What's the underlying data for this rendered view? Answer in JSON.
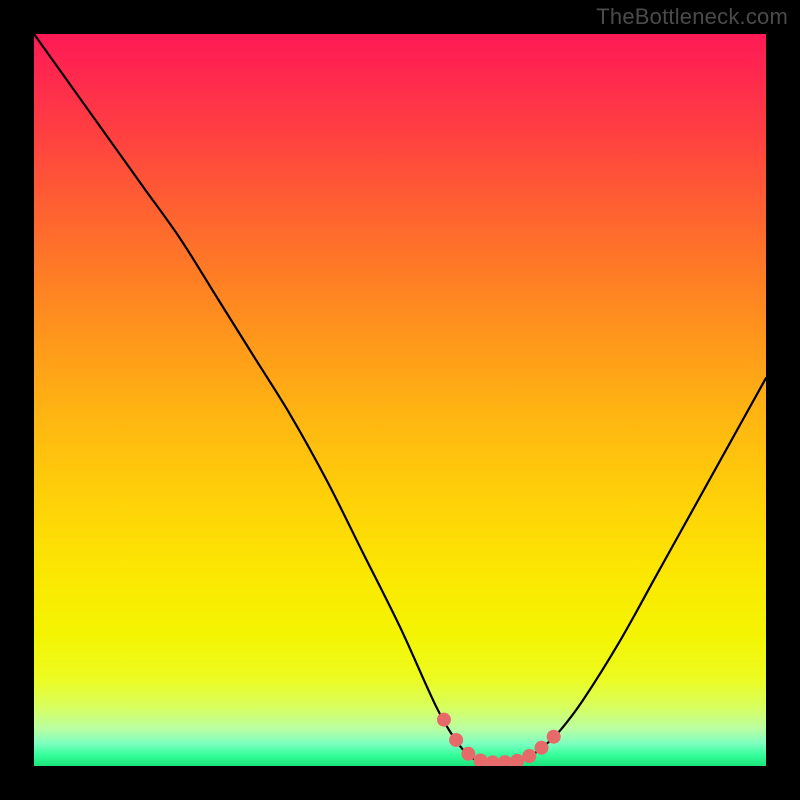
{
  "watermark": "TheBottleneck.com",
  "chart_data": {
    "type": "line",
    "title": "",
    "xlabel": "",
    "ylabel": "",
    "xlim": [
      0,
      100
    ],
    "ylim": [
      0,
      100
    ],
    "series": [
      {
        "name": "bottleneck-curve",
        "x": [
          0,
          5,
          10,
          15,
          20,
          25,
          30,
          35,
          40,
          45,
          50,
          55,
          58,
          60,
          62,
          64,
          66,
          68,
          70,
          72,
          75,
          80,
          85,
          90,
          95,
          100
        ],
        "values": [
          100,
          93,
          86,
          79,
          72,
          64,
          56,
          48,
          39,
          29,
          19,
          8,
          3,
          1,
          0.5,
          0.5,
          0.7,
          1.5,
          3,
          5,
          9,
          17,
          26,
          35,
          44,
          53
        ]
      }
    ],
    "annotations": [
      {
        "name": "optimal-band",
        "x_range": [
          56,
          71
        ],
        "style": "pink-dots"
      }
    ],
    "gradient_stops": [
      {
        "pos": 0.0,
        "color": "#ff1a55"
      },
      {
        "pos": 0.32,
        "color": "#ff7a26"
      },
      {
        "pos": 0.64,
        "color": "#ffd208"
      },
      {
        "pos": 0.88,
        "color": "#ecfb20"
      },
      {
        "pos": 1.0,
        "color": "#1de37a"
      }
    ]
  }
}
